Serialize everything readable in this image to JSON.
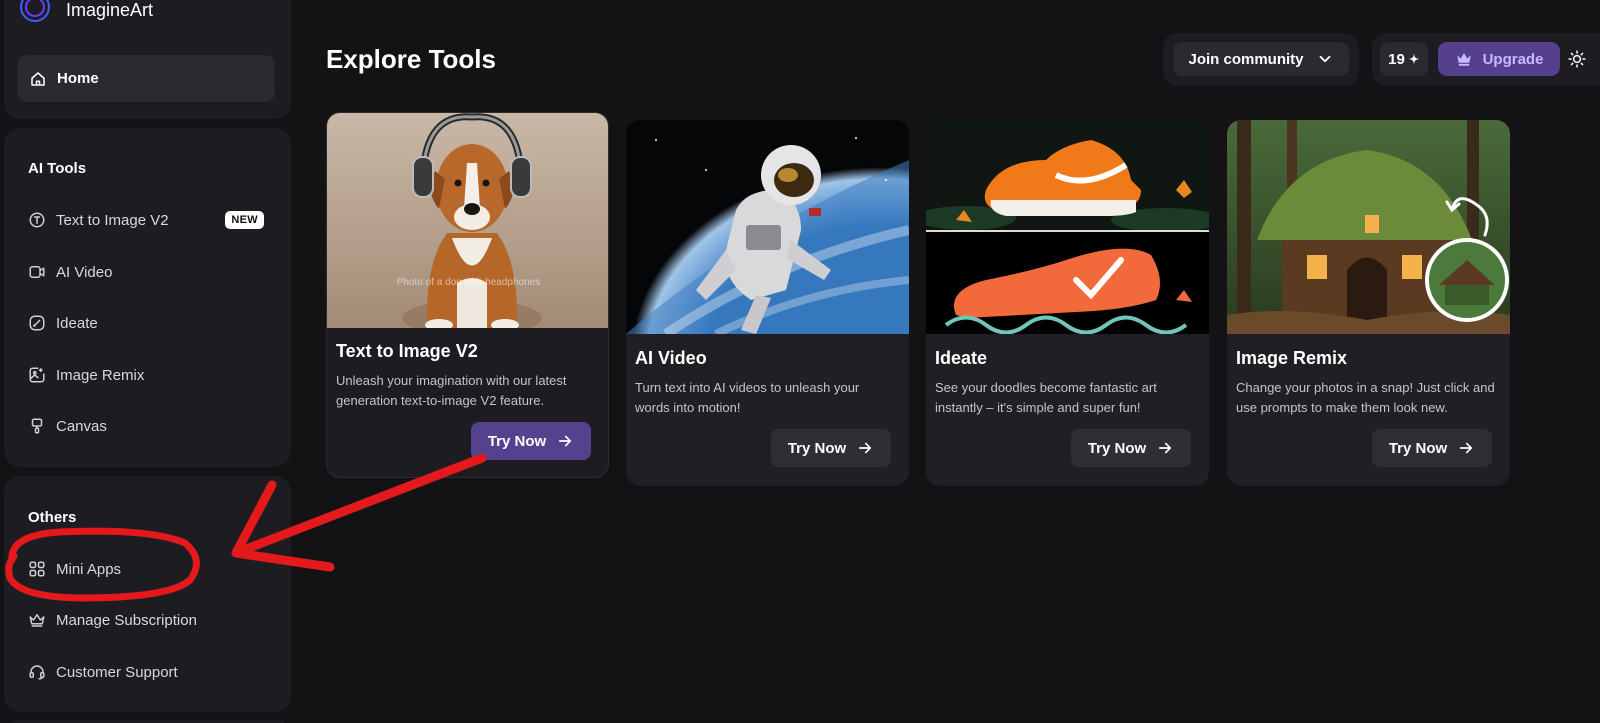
{
  "app": {
    "name": "ImagineArt"
  },
  "sidebar": {
    "home_label": "Home",
    "ai_tools_title": "AI Tools",
    "ai_tools": [
      {
        "label": "Text to Image V2",
        "icon": "text-t-icon",
        "badge": "NEW"
      },
      {
        "label": "AI Video",
        "icon": "video-camera-icon"
      },
      {
        "label": "Ideate",
        "icon": "brush-icon"
      },
      {
        "label": "Image Remix",
        "icon": "image-remix-icon"
      },
      {
        "label": "Canvas",
        "icon": "paint-roller-icon"
      }
    ],
    "others_title": "Others",
    "others": [
      {
        "label": "Mini Apps",
        "icon": "grid-apps-icon"
      },
      {
        "label": "Manage Subscription",
        "icon": "crown-icon"
      },
      {
        "label": "Customer Support",
        "icon": "headset-icon"
      }
    ]
  },
  "header": {
    "title": "Explore Tools",
    "join_community_label": "Join community",
    "credits": "19",
    "upgrade_label": "Upgrade"
  },
  "cards": [
    {
      "title": "Text to Image V2",
      "description": "Unleash your imagination with our latest generation text-to-image V2 feature.",
      "button": "Try Now",
      "image_caption": "Photo of a dog with headphones"
    },
    {
      "title": "AI Video",
      "description": "Turn text into AI videos to unleash your words into motion!",
      "button": "Try Now"
    },
    {
      "title": "Ideate",
      "description": "See your doodles become fantastic art instantly – it's simple and super fun!",
      "button": "Try Now"
    },
    {
      "title": "Image Remix",
      "description": "Change your photos in a snap! Just click and use prompts to make them look new.",
      "button": "Try Now"
    }
  ],
  "colors": {
    "background": "#131316",
    "panel": "#1c1c21",
    "accent_purple": "#54408c",
    "annotation_red": "#e3191b"
  }
}
